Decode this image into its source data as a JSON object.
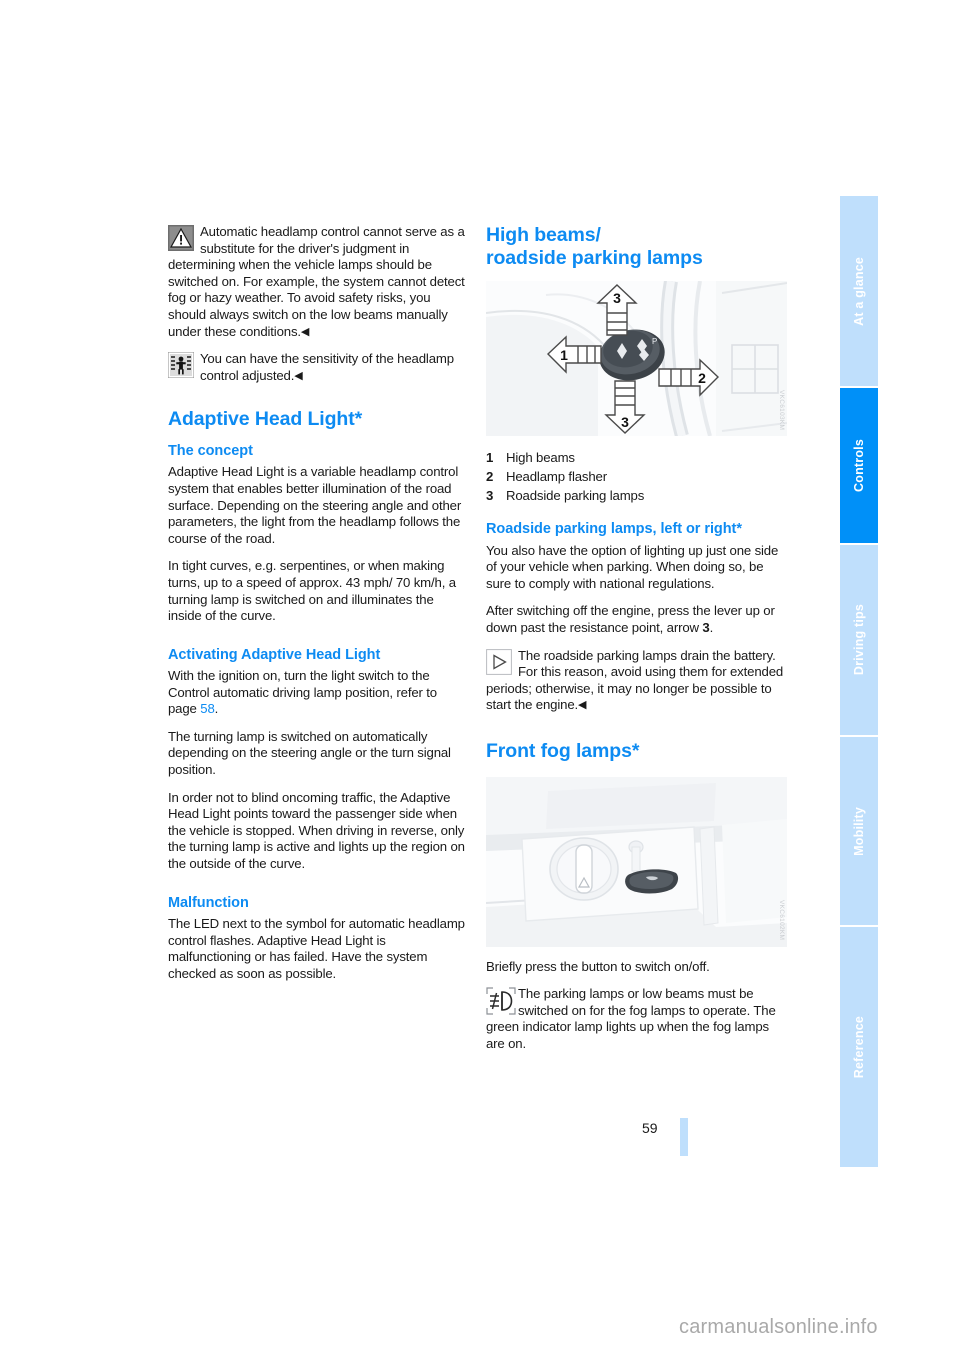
{
  "document": {
    "page_number": "59",
    "watermark": "carmanualsonline.info"
  },
  "sidebar": {
    "tabs": [
      {
        "label": "At a glance",
        "active": false
      },
      {
        "label": "Controls",
        "active": true
      },
      {
        "label": "Driving tips",
        "active": false
      },
      {
        "label": "Mobility",
        "active": false
      },
      {
        "label": "Reference",
        "active": false
      }
    ]
  },
  "left_column": {
    "warning_note": {
      "icon": "warning-triangle-icon",
      "text": "Automatic headlamp control cannot serve as a substitute for the driver's judgment in determining when the vehicle lamps should be switched on. For example, the system cannot detect fog or hazy weather. To avoid safety risks, you should always switch on the low beams manually under these conditions.",
      "end_mark": "◀"
    },
    "service_note": {
      "icon": "service-person-icon",
      "text": "You can have the sensitivity of the headlamp control adjusted.",
      "end_mark": "◀"
    },
    "heading": "Adaptive Head Light*",
    "sections": [
      {
        "heading": "The concept",
        "paragraphs": [
          "Adaptive Head Light is a variable headlamp control system that enables better illumination of the road surface. Depending on the steering angle and other parameters, the light from the headlamp follows the course of the road.",
          "In tight curves, e.g. serpentines, or when making turns, up to a speed of approx. 43 mph/ 70 km/h, a turning lamp is switched on and illuminates the inside of the curve."
        ]
      },
      {
        "heading": "Activating Adaptive Head Light",
        "paragraph_with_link_prefix": "With the ignition on, turn the light switch to the Control automatic driving lamp position, refer to page ",
        "page_link": "58",
        "paragraph_with_link_suffix": ".",
        "paragraphs": [
          "The turning lamp is switched on automatically depending on the steering angle or the turn signal position.",
          "In order not to blind oncoming traffic, the Adaptive Head Light points toward the passenger side when the vehicle is stopped. When driving in reverse, only the turning lamp is active and lights up the region on the outside of the curve."
        ]
      },
      {
        "heading": "Malfunction",
        "paragraphs": [
          "The LED next to the symbol for automatic headlamp control flashes. Adaptive Head Light is malfunctioning or has failed. Have the system checked as soon as possible."
        ]
      }
    ]
  },
  "right_column": {
    "heading_line1": "High beams/",
    "heading_line2": "roadside parking lamps",
    "figure_stalk": {
      "name": "turn-signal-stalk-illustration",
      "credit": "VKC6103KM",
      "callouts": [
        "1",
        "2",
        "3",
        "3"
      ]
    },
    "legend": [
      {
        "num": "1",
        "label": "High beams"
      },
      {
        "num": "2",
        "label": "Headlamp flasher"
      },
      {
        "num": "3",
        "label": "Roadside parking lamps"
      }
    ],
    "subsection": {
      "heading": "Roadside parking lamps, left or right*",
      "paragraphs": [
        "You also have the option of lighting up just one side of your vehicle when parking. When doing so, be sure to comply with national regulations."
      ],
      "arrow_paragraph_prefix": "After switching off the engine, press the lever up or down past the resistance point, arrow ",
      "arrow_paragraph_bold": "3",
      "arrow_paragraph_suffix": "."
    },
    "info_note": {
      "icon": "triangle-play-icon",
      "text": "The roadside parking lamps drain the battery. For this reason, avoid using them for extended periods; otherwise, it may no longer be possible to start the engine.",
      "end_mark": "◀"
    },
    "fog_heading": "Front fog lamps*",
    "figure_fog": {
      "name": "light-switch-panel-illustration",
      "credit": "VKC6102KM"
    },
    "fog_instruction": "Briefly press the button to switch on/off.",
    "fog_note": {
      "icon": "front-fog-lamp-icon",
      "text": "The parking lamps or low beams must be switched on for the fog lamps to operate. The green indicator lamp lights up when the fog lamps are on."
    }
  },
  "colors": {
    "heading_blue": "#0d8bf2",
    "tab_active_blue": "#0090f8",
    "tab_inactive_blue": "#bfdffc",
    "body_text": "#1a1a1a"
  }
}
